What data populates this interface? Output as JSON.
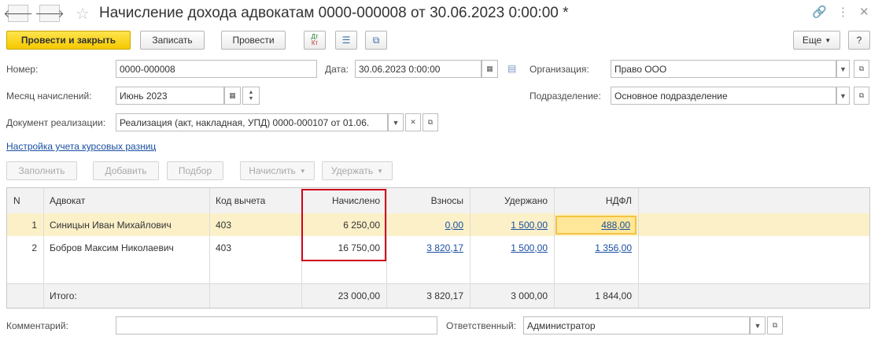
{
  "window": {
    "title": "Начисление дохода адвокатам 0000-000008 от 30.06.2023 0:00:00 *"
  },
  "toolbar": {
    "post_close": "Провести и закрыть",
    "write": "Записать",
    "post": "Провести",
    "dt_kt": "ДтКт",
    "more": "Еще",
    "help": "?"
  },
  "form": {
    "number_label": "Номер:",
    "number_value": "0000-000008",
    "date_label": "Дата:",
    "date_value": "30.06.2023  0:00:00",
    "org_label": "Организация:",
    "org_value": "Право ООО",
    "month_label": "Месяц начислений:",
    "month_value": "Июнь 2023",
    "dept_label": "Подразделение:",
    "dept_value": "Основное подразделение",
    "doc_label": "Документ реализации:",
    "doc_value": "Реализация (акт, накладная, УПД) 0000-000107 от 01.06.",
    "fx_link": "Настройка учета курсовых разниц"
  },
  "table_toolbar": {
    "fill": "Заполнить",
    "add": "Добавить",
    "select": "Подбор",
    "accrue": "Начислить",
    "withhold": "Удержать"
  },
  "table": {
    "columns": [
      "N",
      "Адвокат",
      "Код вычета",
      "Начислено",
      "Взносы",
      "Удержано",
      "НДФЛ"
    ],
    "rows": [
      {
        "n": "1",
        "name": "Синицын Иван Михайлович",
        "code": "403",
        "accrued": "6 250,00",
        "contrib": "0,00",
        "withheld": "1 500,00",
        "ndfl": "488,00"
      },
      {
        "n": "2",
        "name": "Бобров Максим Николаевич",
        "code": "403",
        "accrued": "16 750,00",
        "contrib": "3 820,17",
        "withheld": "1 500,00",
        "ndfl": "1 356,00"
      }
    ],
    "footer": {
      "label": "Итого:",
      "accrued": "23 000,00",
      "contrib": "3 820,17",
      "withheld": "3 000,00",
      "ndfl": "1 844,00"
    }
  },
  "bottom": {
    "comment_label": "Комментарий:",
    "comment_value": "",
    "resp_label": "Ответственный:",
    "resp_value": "Администратор"
  },
  "colors": {
    "accent_yellow": "#f5c800",
    "highlight_red": "#d0021b",
    "link_blue": "#1a4fa3",
    "selected_row": "#fbf0c8"
  }
}
